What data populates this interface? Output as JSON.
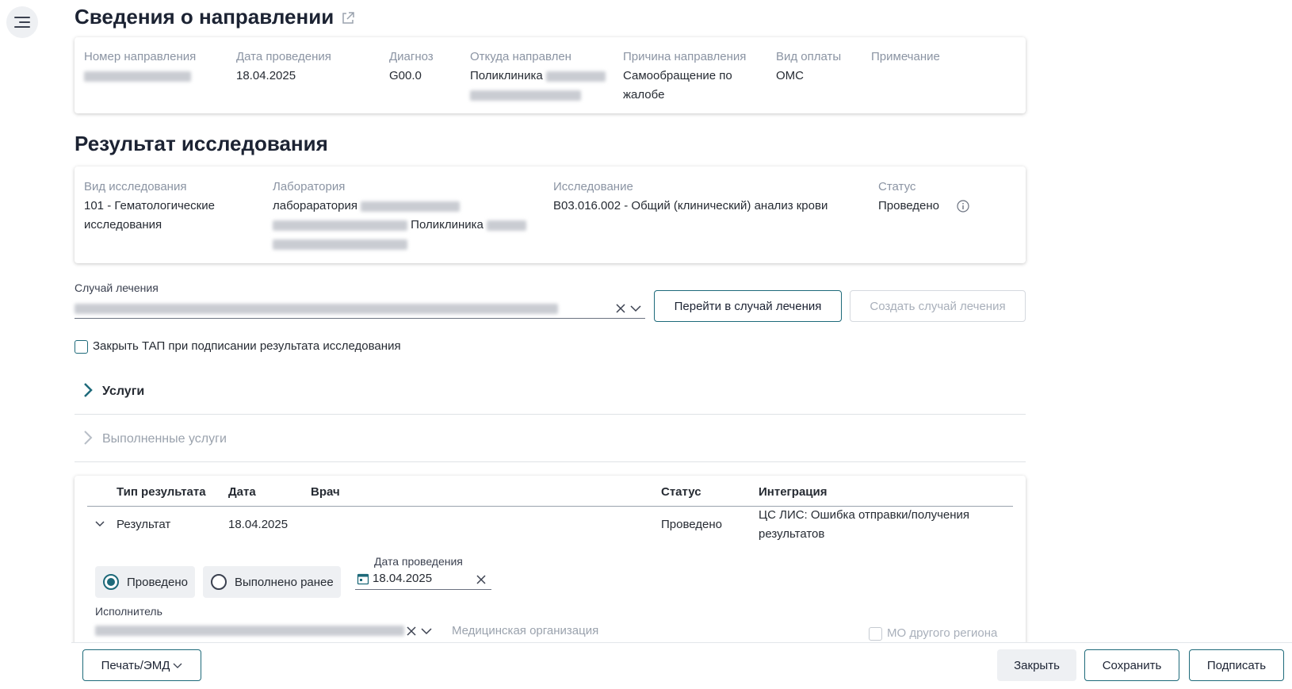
{
  "direction": {
    "title": "Сведения о направлении",
    "fields": [
      {
        "label": "Номер направления",
        "value": ""
      },
      {
        "label": "Дата проведения",
        "value": "18.04.2025"
      },
      {
        "label": "Диагноз",
        "value": "G00.0"
      },
      {
        "label": "Откуда направлен",
        "value": "Поликлиника"
      },
      {
        "label": "Причина направления",
        "value": "Самообращение по жалобе"
      },
      {
        "label": "Вид оплаты",
        "value": "ОМС"
      },
      {
        "label": "Примечание",
        "value": ""
      }
    ]
  },
  "result": {
    "title": "Результат исследования",
    "type_label": "Вид исследования",
    "type_value": "101 - Гематологические исследования",
    "lab_label": "Лаборатория",
    "lab_value_1": "лабораратория",
    "lab_value_2": "Поликлиника",
    "study_label": "Исследование",
    "study_value": "B03.016.002 - Общий (клинический) анализ крови",
    "status_label": "Статус",
    "status_value": "Проведено"
  },
  "case": {
    "label": "Случай лечения",
    "goto_button": "Перейти в случай лечения",
    "create_button": "Создать случай лечения",
    "close_tap_checkbox": "Закрыть ТАП при подписании результата исследования"
  },
  "sections": {
    "services": "Услуги",
    "done_services": "Выполненные услуги"
  },
  "table": {
    "headers": [
      "Тип результата",
      "Дата",
      "Врач",
      "Статус",
      "Интеграция"
    ],
    "row": {
      "type": "Результат",
      "date": "18.04.2025",
      "doctor": "",
      "status": "Проведено",
      "integration": "ЦС ЛИС: Ошибка отправки/получения результатов"
    }
  },
  "detail": {
    "radio_done": "Проведено",
    "radio_earlier": "Выполнено ранее",
    "date_label": "Дата проведения",
    "date_value": "18.04.2025",
    "executor_label": "Исполнитель",
    "med_org_placeholder": "Медицинская организация",
    "other_region_checkbox": "МО другого региона"
  },
  "footer": {
    "print_button": "Печать/ЭМД",
    "close_button": "Закрыть",
    "save_button": "Сохранить",
    "sign_button": "Подписать"
  },
  "colors": {
    "accent": "#1e6a7a",
    "muted_label": "#8b94a3",
    "text": "#262b33"
  }
}
